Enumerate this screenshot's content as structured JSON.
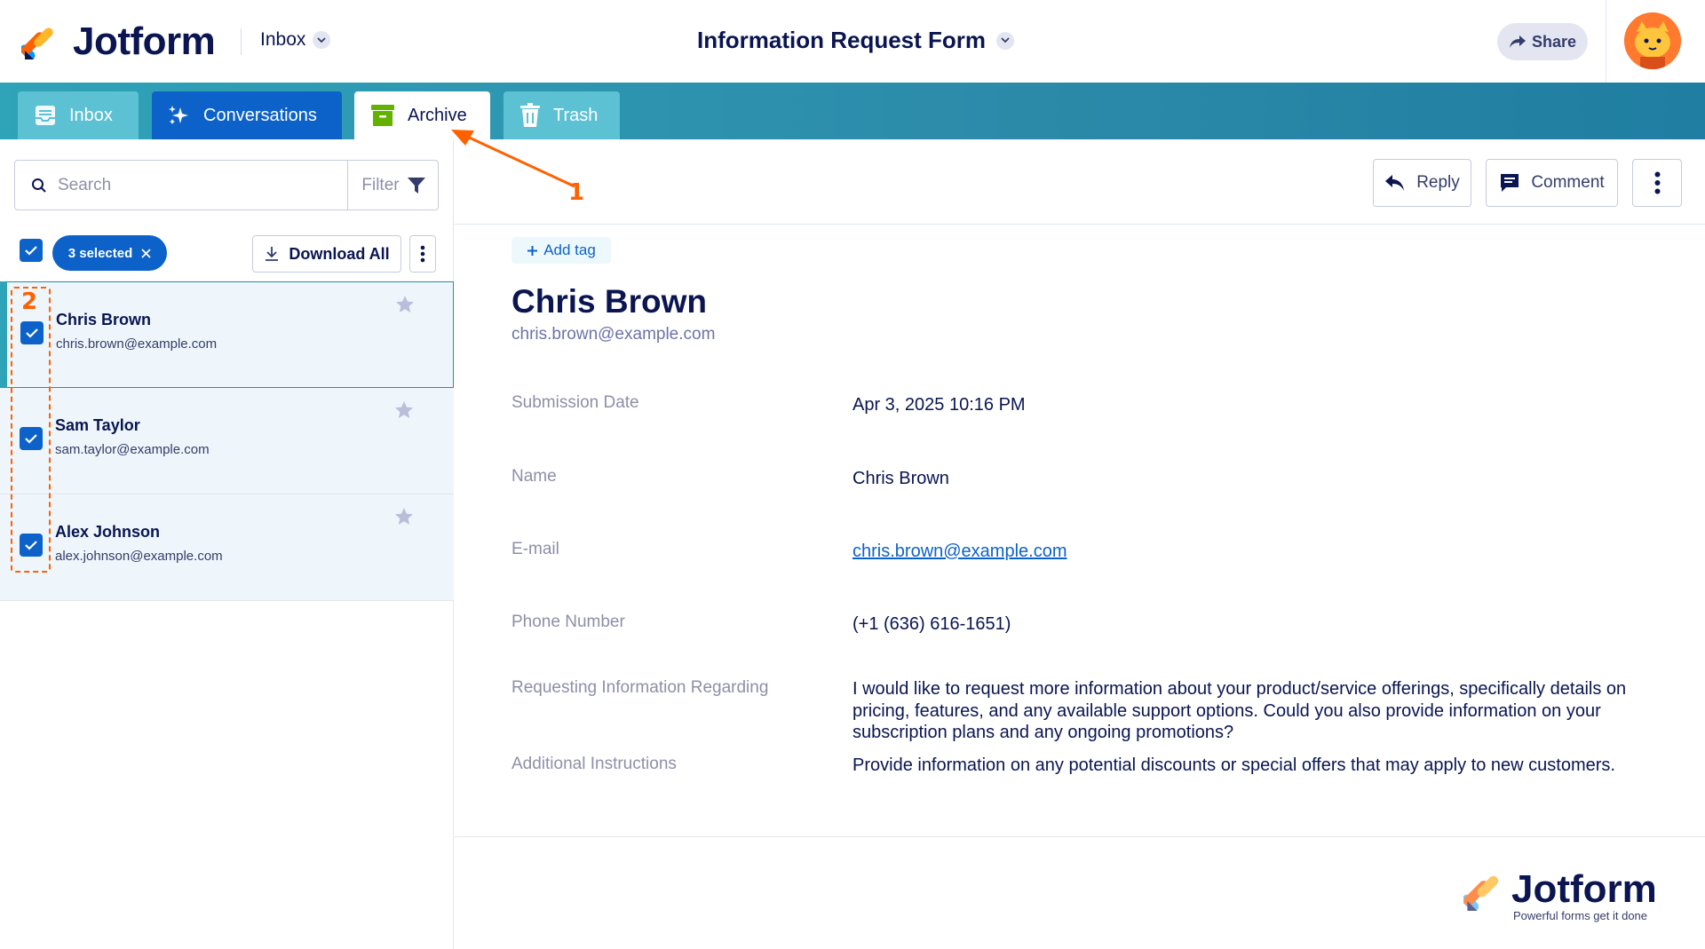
{
  "header": {
    "brand": "Jotform",
    "inbox_dropdown": "Inbox",
    "form_title": "Information Request Form",
    "share_label": "Share"
  },
  "tabs": [
    {
      "label": "Inbox",
      "icon": "inbox-icon"
    },
    {
      "label": "Conversations",
      "icon": "sparkle-icon"
    },
    {
      "label": "Archive",
      "icon": "archive-icon",
      "active": true
    },
    {
      "label": "Trash",
      "icon": "trash-icon"
    }
  ],
  "sidebar": {
    "search_placeholder": "Search",
    "filter_label": "Filter",
    "selected_label": "3 selected",
    "download_all_label": "Download All",
    "submissions": [
      {
        "name": "Chris Brown",
        "email": "chris.brown@example.com",
        "checked": true,
        "active": true
      },
      {
        "name": "Sam Taylor",
        "email": "sam.taylor@example.com",
        "checked": true
      },
      {
        "name": "Alex Johnson",
        "email": "alex.johnson@example.com",
        "checked": true
      }
    ]
  },
  "detail": {
    "reply_label": "Reply",
    "comment_label": "Comment",
    "add_tag_label": "Add tag",
    "name": "Chris Brown",
    "email": "chris.brown@example.com",
    "fields": [
      {
        "label": "Submission Date",
        "value": "Apr 3, 2025 10:16 PM"
      },
      {
        "label": "Name",
        "value": "Chris Brown"
      },
      {
        "label": "E-mail",
        "value": "chris.brown@example.com",
        "link": true
      },
      {
        "label": "Phone Number",
        "value": "(+1 (636) 616-1651)"
      },
      {
        "label": "Requesting Information Regarding",
        "value": "I would like to request more information about your product/service offerings, specifically details on pricing, features, and any available support options. Could you also provide information on your subscription plans and any ongoing promotions?"
      },
      {
        "label": "Additional Instructions",
        "value": "Provide information on any potential discounts or special offers that may apply to new customers."
      }
    ]
  },
  "annotations": {
    "step1": "1",
    "step2": "2",
    "color": "#ff6100"
  },
  "footer": {
    "brand": "Jotform",
    "tagline": "Powerful forms get it done"
  },
  "colors": {
    "navy": "#0a1551",
    "blue": "#0d62c9",
    "teal": "#2c8aa9",
    "orange": "#ff6100"
  }
}
